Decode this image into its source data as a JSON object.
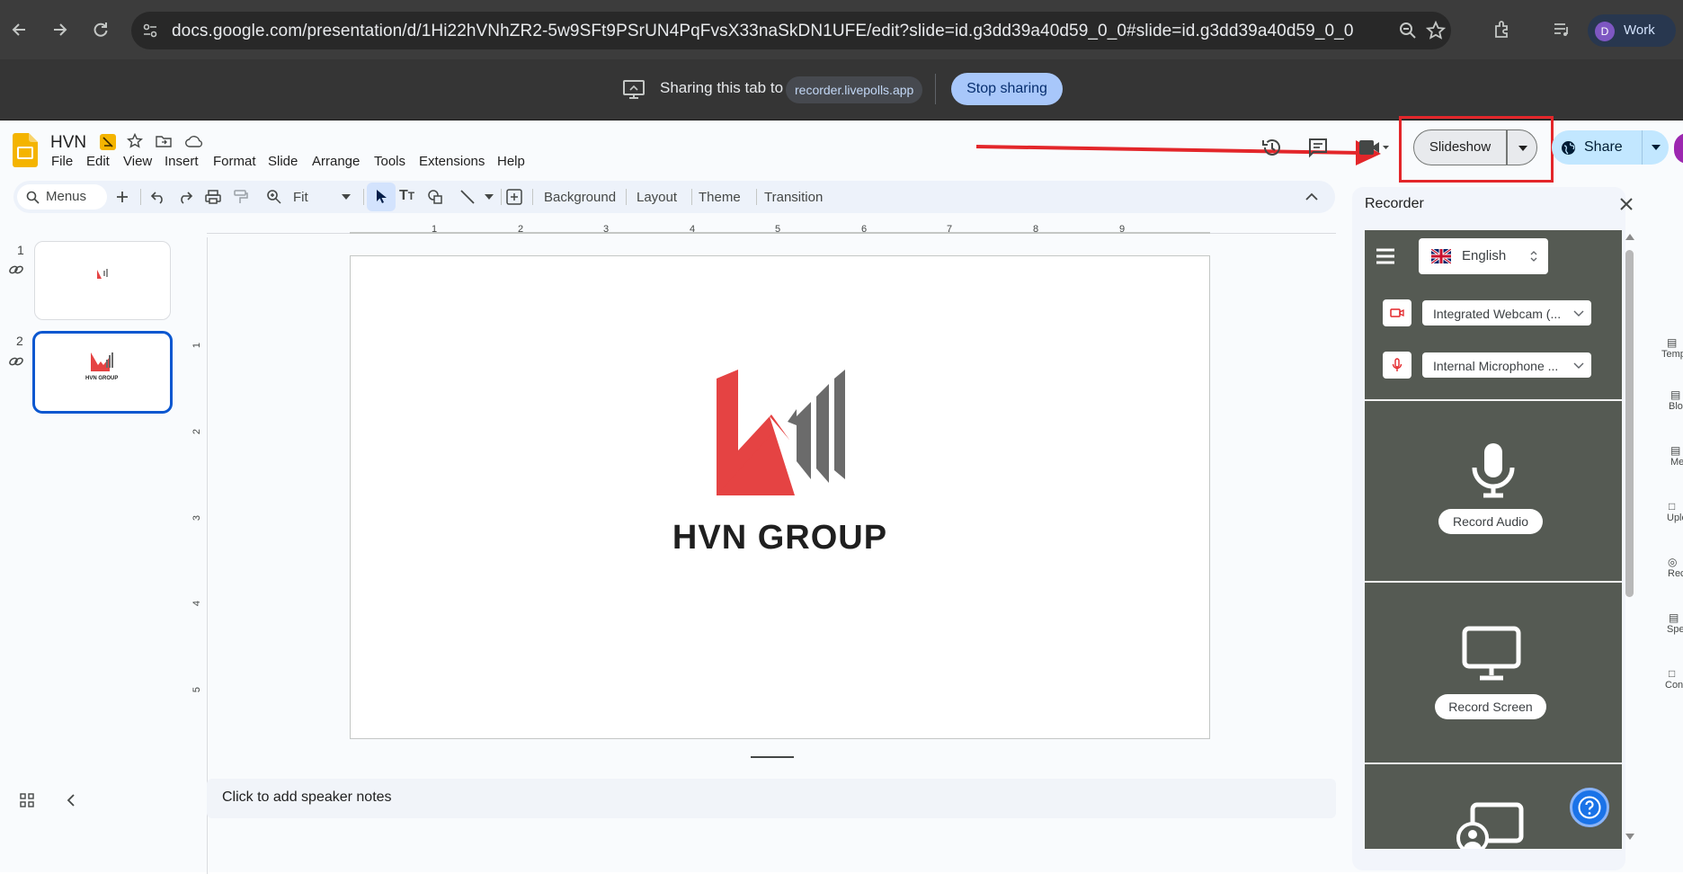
{
  "browser": {
    "url": "docs.google.com/presentation/d/1Hi22hVNhZR2-5w9SFt9PSrUN4PqFvsX33naSkDN1UFE/edit?slide=id.g3dd39a40d59_0_0#slide=id.g3dd39a40d59_0_0",
    "profile_initial": "D",
    "profile_label": "Work"
  },
  "sharebar": {
    "sharing_text": "Sharing this tab to",
    "target": "recorder.livepolls.app",
    "stop_label": "Stop sharing"
  },
  "doc": {
    "title": "HVN",
    "menu": [
      "File",
      "Edit",
      "View",
      "Insert",
      "Format",
      "Slide",
      "Arrange",
      "Tools",
      "Extensions",
      "Help"
    ]
  },
  "toolbar": {
    "search_label": "Menus",
    "zoom_label": "Fit",
    "background_label": "Background",
    "layout_label": "Layout",
    "theme_label": "Theme",
    "transition_label": "Transition"
  },
  "header": {
    "slideshow_label": "Slideshow",
    "share_label": "Share"
  },
  "slides": {
    "thumb1_num": "1",
    "thumb2_num": "2",
    "thumb2_caption": "HVN GROUP"
  },
  "ruler": {
    "h_ticks": [
      "1",
      "2",
      "3",
      "4",
      "5",
      "6",
      "7",
      "8",
      "9"
    ],
    "v_ticks": [
      "1",
      "2",
      "3",
      "4",
      "5"
    ]
  },
  "slide": {
    "logo_text": "HVN GROUP"
  },
  "notes": {
    "placeholder": "Click to add speaker notes"
  },
  "recorder": {
    "title": "Recorder",
    "language": "English",
    "webcam": "Integrated Webcam (...",
    "microphone": "Internal Microphone ...",
    "record_audio": "Record Audio",
    "record_screen": "Record Screen"
  },
  "rail": {
    "items": [
      "Temp",
      "Blo",
      "Me",
      "Uplo",
      "Rec",
      "Spe",
      "Con"
    ]
  },
  "colors": {
    "accent_red": "#e3262a",
    "logo_red": "#e54343",
    "logo_gray": "#6b6b6b",
    "selection_blue": "#0b57d0"
  }
}
